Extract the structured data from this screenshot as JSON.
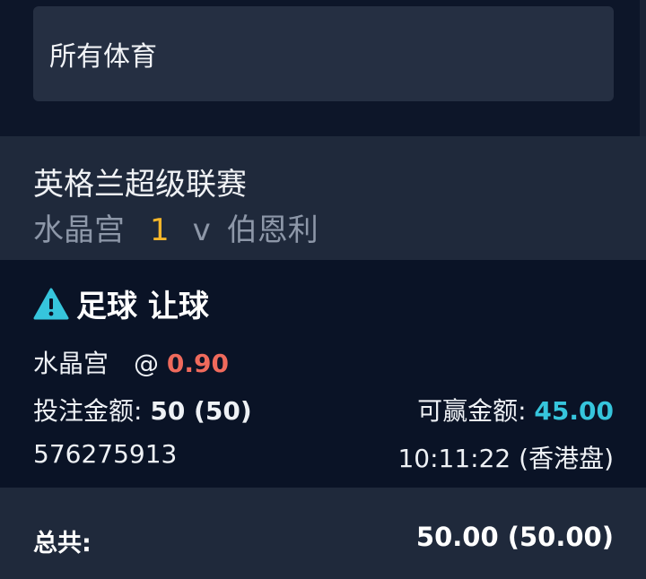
{
  "sport_filter": {
    "value": "所有体育"
  },
  "match": {
    "league": "英格兰超级联赛",
    "home_team": "水晶宫",
    "score": "1",
    "vs": "v",
    "away_team": "伯恩利"
  },
  "bet": {
    "warning_icon": "warning-triangle-icon",
    "market": "足球 让球",
    "selection": "水晶宫",
    "at_symbol": "@",
    "odds": "0.90",
    "stake_label": "投注金额:",
    "stake_value": "50 (50)",
    "win_label": "可赢金额:",
    "win_value": "45.00",
    "ticket_id": "576275913",
    "time": "10:11:22 (香港盘)"
  },
  "total": {
    "label": "总共:",
    "value": "50.00 (50.00)"
  },
  "colors": {
    "odds": "#ef6a5c",
    "win": "#36c5dc",
    "score": "#f4b52a",
    "warning": "#36c5dc"
  }
}
